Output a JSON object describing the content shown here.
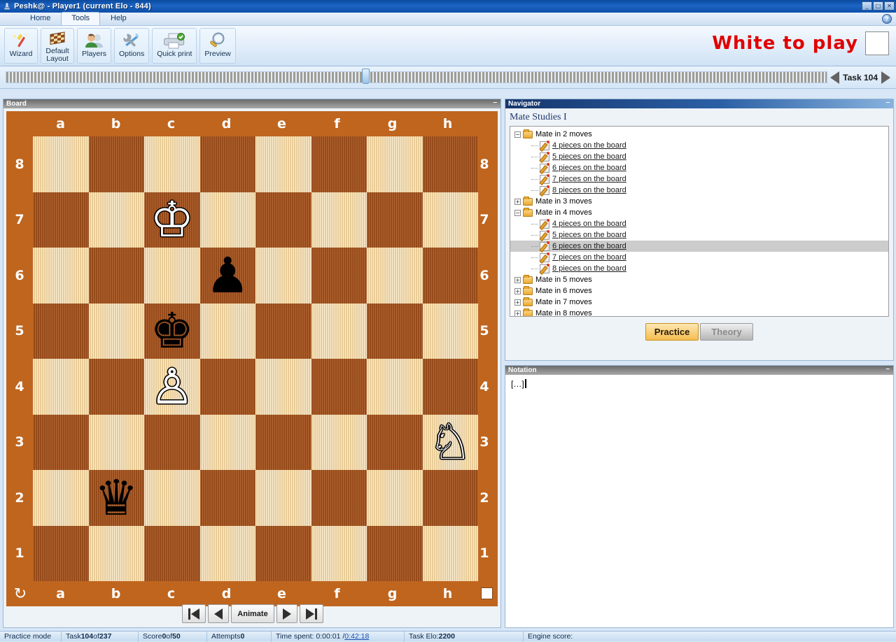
{
  "window": {
    "title": "Peshk@ - Player1 (current Elo - 844)",
    "icon": "chess-pawn-icon",
    "minimize": "_",
    "maximize": "□",
    "close": "✕"
  },
  "menu": {
    "tabs": [
      {
        "label": "Home",
        "active": false
      },
      {
        "label": "Tools",
        "active": true
      },
      {
        "label": "Help",
        "active": false
      }
    ],
    "help_icon": "?"
  },
  "ribbon": {
    "buttons": [
      {
        "label": "Wizard",
        "icon": "magic-wand-icon"
      },
      {
        "label": "Default\nLayout",
        "label_line1": "Default",
        "label_line2": "Layout",
        "icon": "checkerboard-icon"
      },
      {
        "label": "Players",
        "icon": "players-icon"
      },
      {
        "label": "Options",
        "icon": "tools-icon"
      },
      {
        "label": "Quick print",
        "icon": "printer-icon"
      },
      {
        "label": "Preview",
        "icon": "magnifier-icon"
      }
    ],
    "turn_indicator": {
      "text": "White to play",
      "color": "#e00000",
      "swatch_color": "#ffffff"
    }
  },
  "task_strip": {
    "prev_icon": "prev-task-arrow",
    "next_icon": "next-task-arrow",
    "label": "Task 104",
    "marker_position_px": 508
  },
  "board_panel": {
    "title": "Board",
    "minimize": "–",
    "files": [
      "a",
      "b",
      "c",
      "d",
      "e",
      "f",
      "g",
      "h"
    ],
    "ranks": [
      "8",
      "7",
      "6",
      "5",
      "4",
      "3",
      "2",
      "1"
    ],
    "flip_icon": "flip-board-icon",
    "side_to_move_swatch": "#ffffff",
    "colors": {
      "light_square": "#f2d9a8",
      "dark_square": "#a9561e",
      "border": "#c0651e"
    },
    "pieces": [
      {
        "square": "c7",
        "piece": "king",
        "color": "white",
        "glyph": "♔"
      },
      {
        "square": "d6",
        "piece": "pawn",
        "color": "black",
        "glyph": "♟"
      },
      {
        "square": "c5",
        "piece": "king",
        "color": "black",
        "glyph": "♚"
      },
      {
        "square": "c4",
        "piece": "pawn",
        "color": "white",
        "glyph": "♙"
      },
      {
        "square": "h3",
        "piece": "knight",
        "color": "white",
        "glyph": "♘"
      },
      {
        "square": "b2",
        "piece": "queen",
        "color": "black",
        "glyph": "♛"
      }
    ],
    "controls": [
      {
        "name": "first-move-button",
        "icon": "skip-to-start"
      },
      {
        "name": "previous-move-button",
        "icon": "step-back"
      },
      {
        "name": "animate-button",
        "label": "Animate"
      },
      {
        "name": "next-move-button",
        "icon": "step-forward"
      },
      {
        "name": "last-move-button",
        "icon": "skip-to-end"
      }
    ]
  },
  "navigator": {
    "title": "Navigator",
    "minimize": "–",
    "heading": "Mate Studies I",
    "tree": [
      {
        "level": 0,
        "type": "folder",
        "expander": "−",
        "label": "Mate in 2 moves",
        "selected": false
      },
      {
        "level": 1,
        "type": "leaf",
        "label": "4 pieces on the board",
        "selected": false
      },
      {
        "level": 1,
        "type": "leaf",
        "label": "5 pieces on the board",
        "selected": false
      },
      {
        "level": 1,
        "type": "leaf",
        "label": "6 pieces on the board",
        "selected": false
      },
      {
        "level": 1,
        "type": "leaf",
        "label": "7 pieces on the board",
        "selected": false
      },
      {
        "level": 1,
        "type": "leaf",
        "label": "8 pieces on the board",
        "selected": false
      },
      {
        "level": 0,
        "type": "folder",
        "expander": "+",
        "label": "Mate in 3 moves",
        "selected": false
      },
      {
        "level": 0,
        "type": "folder",
        "expander": "−",
        "label": "Mate in 4 moves",
        "selected": false
      },
      {
        "level": 1,
        "type": "leaf",
        "label": "4 pieces on the board",
        "selected": false
      },
      {
        "level": 1,
        "type": "leaf",
        "label": "5 pieces on the board",
        "selected": false
      },
      {
        "level": 1,
        "type": "leaf",
        "label": "6 pieces on the board",
        "selected": true
      },
      {
        "level": 1,
        "type": "leaf",
        "label": "7 pieces on the board",
        "selected": false
      },
      {
        "level": 1,
        "type": "leaf",
        "label": "8 pieces on the board",
        "selected": false
      },
      {
        "level": 0,
        "type": "folder",
        "expander": "+",
        "label": "Mate in 5 moves",
        "selected": false
      },
      {
        "level": 0,
        "type": "folder",
        "expander": "+",
        "label": "Mate in 6 moves",
        "selected": false
      },
      {
        "level": 0,
        "type": "folder",
        "expander": "+",
        "label": "Mate in 7 moves",
        "selected": false
      },
      {
        "level": 0,
        "type": "folder",
        "expander": "+",
        "label": "Mate in 8 moves",
        "selected": false
      }
    ],
    "buttons": {
      "practice": "Practice",
      "theory": "Theory"
    }
  },
  "notation": {
    "title": "Notation",
    "minimize": "–",
    "text": "[…]"
  },
  "status_bar": {
    "mode": "Practice mode",
    "task_label": "Task ",
    "task_current": "104",
    "task_of": " of ",
    "task_total": "237",
    "score_label": "Score ",
    "score_value": "0",
    "score_of": " of ",
    "score_total": "50",
    "attempts_label": "Attempts ",
    "attempts_value": "0",
    "time_label": "Time spent: 0:00:01 / ",
    "time_total": "0:42:18",
    "task_elo_label": "Task Elo: ",
    "task_elo_value": "2200",
    "engine_score": "Engine score:"
  }
}
